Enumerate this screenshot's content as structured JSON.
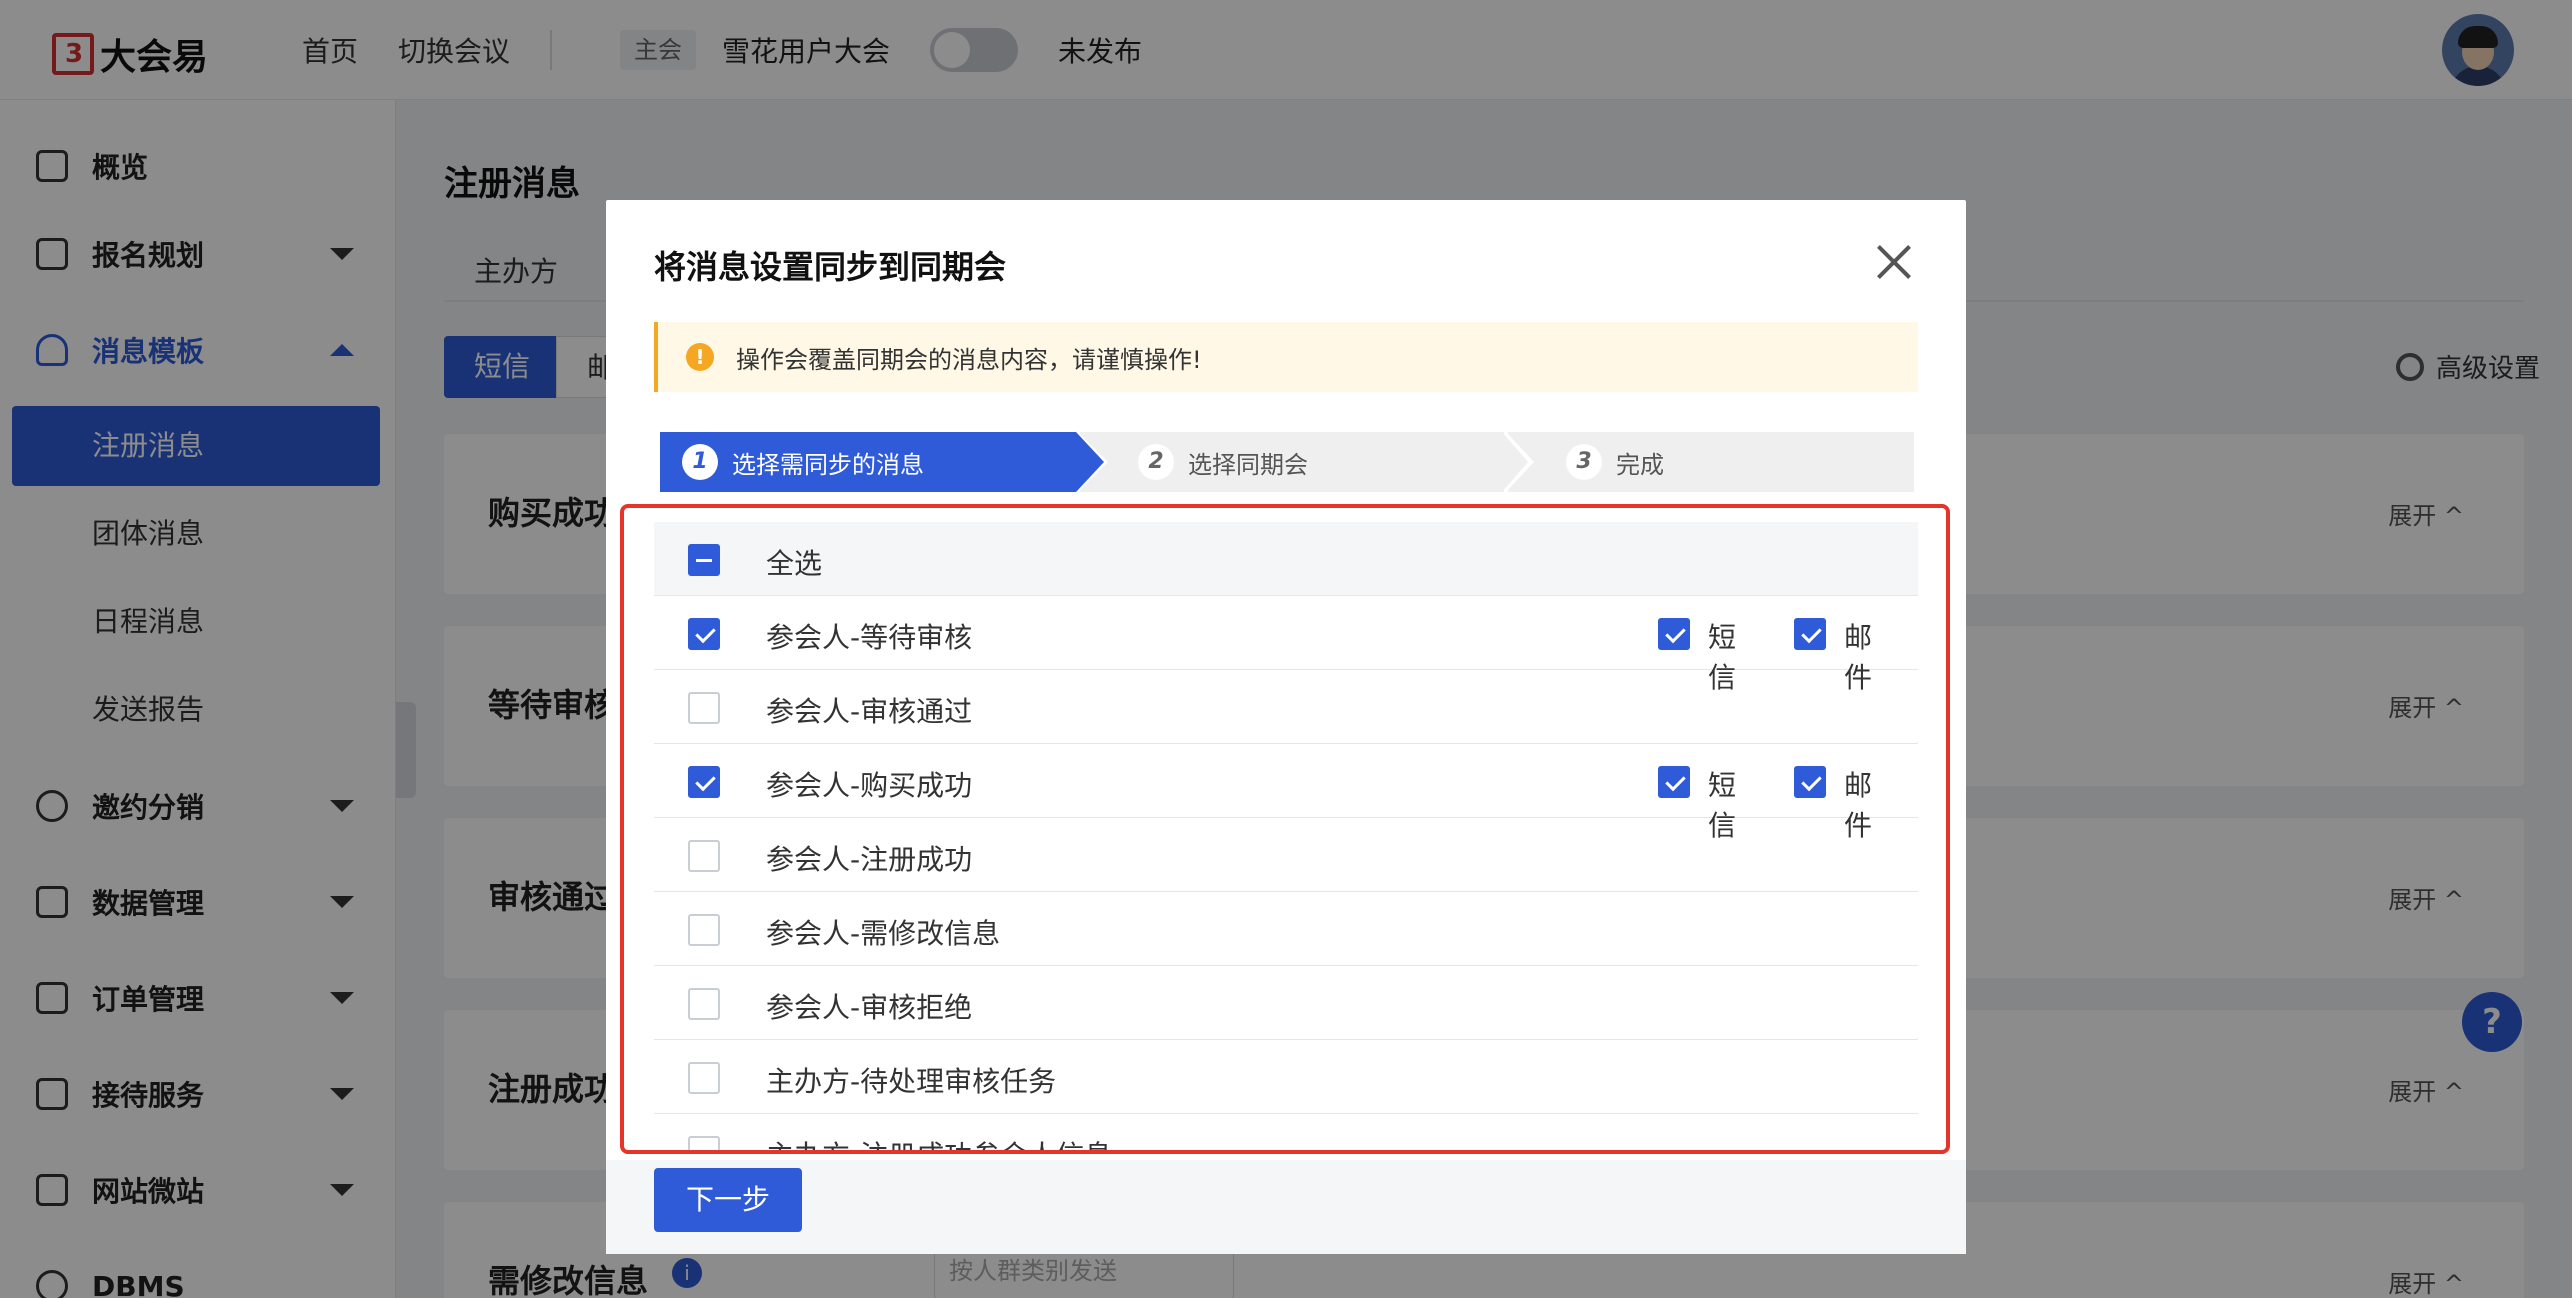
{
  "header": {
    "logo_mark": "3",
    "logo_text": "大会易",
    "nav_home": "首页",
    "nav_switch": "切换会议",
    "conf_tag": "主会",
    "conf_name": "雪花用户大会",
    "publish_status": "未发布"
  },
  "sidebar": {
    "overview": "概览",
    "registration": "报名规划",
    "message_templates": "消息模板",
    "sub_register": "注册消息",
    "sub_group": "团体消息",
    "sub_schedule": "日程消息",
    "sub_report": "发送报告",
    "invite": "邀约分销",
    "data": "数据管理",
    "orders": "订单管理",
    "reception": "接待服务",
    "website": "网站微站",
    "dbms": "DBMS"
  },
  "main": {
    "page_title": "注册消息",
    "tab_organizer": "主办方",
    "channel_sms": "短信",
    "channel_mail": "邮",
    "advanced": "高级设置",
    "cards": [
      "购买成功",
      "等待审核",
      "审核通过",
      "注册成功",
      "需修改信息"
    ],
    "expand_label": "展开 ^",
    "dropdown_placeholder": "按人群类别发送"
  },
  "modal": {
    "title": "将消息设置同步到同期会",
    "warning": "操作会覆盖同期会的消息内容，请谨慎操作!",
    "steps": [
      {
        "num": "1",
        "label": "选择需同步的消息"
      },
      {
        "num": "2",
        "label": "选择同期会"
      },
      {
        "num": "3",
        "label": "完成"
      }
    ],
    "select_all": "全选",
    "channel_sms": "短信",
    "channel_mail": "邮件",
    "rows": [
      {
        "label": "参会人-等待审核",
        "checked": true
      },
      {
        "label": "参会人-审核通过",
        "checked": false
      },
      {
        "label": "参会人-购买成功",
        "checked": true
      },
      {
        "label": "参会人-注册成功",
        "checked": false
      },
      {
        "label": "参会人-需修改信息",
        "checked": false
      },
      {
        "label": "参会人-审核拒绝",
        "checked": false
      },
      {
        "label": "主办方-待处理审核任务",
        "checked": false
      },
      {
        "label": "主办方-注册成功参会人信息",
        "checked": false
      }
    ],
    "next_button": "下一步"
  },
  "colors": {
    "primary": "#2f5bd8",
    "warning": "#f5a623",
    "highlight_border": "#e5352b"
  }
}
